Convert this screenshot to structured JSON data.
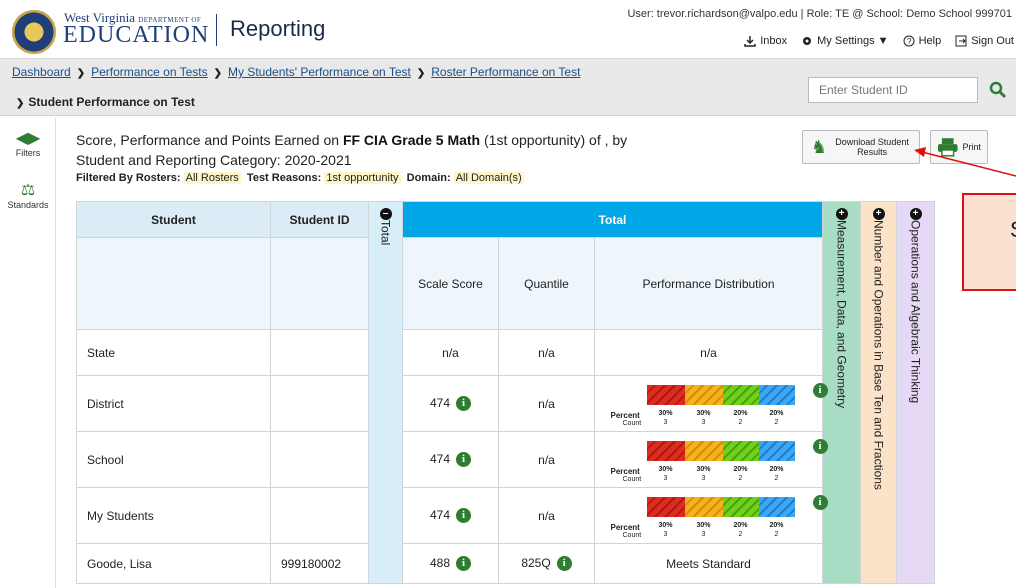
{
  "header": {
    "org_line": "West Virginia",
    "org_dept": "DEPARTMENT OF",
    "org_name": "EDUCATION",
    "app_title": "Reporting",
    "user_line": "User: trevor.richardson@valpo.edu  |  Role: TE @ School: Demo School 999701",
    "inbox": "Inbox",
    "settings": "My Settings ▼",
    "help": "Help",
    "signout": "Sign Out"
  },
  "breadcrumb": {
    "items": [
      "Dashboard",
      "Performance on Tests",
      "My Students' Performance on Test",
      "Roster Performance on Test"
    ],
    "current": "Student Performance on Test"
  },
  "search": {
    "placeholder": "Enter Student ID"
  },
  "rail": {
    "filters": "Filters",
    "standards": "Standards"
  },
  "report": {
    "title_prefix": "Score, Performance and Points Earned on ",
    "test_name": "FF CIA Grade 5 Math",
    "title_suffix": " (1st opportunity) of , by",
    "subtitle": "Student and Reporting Category: 2020-2021",
    "filtered_by": "Filtered By",
    "rosters_label": "Rosters:",
    "rosters_value": "All Rosters",
    "reasons_label": "Test Reasons:",
    "reasons_value": "1st opportunity",
    "domain_label": "Domain:",
    "domain_value": "All Domain(s)",
    "download_label": "Download Student Results",
    "print_label": "Print"
  },
  "callout": {
    "text": "S"
  },
  "table": {
    "headers": {
      "student": "Student",
      "student_id": "Student ID",
      "total_collapsed": "Total",
      "total": "Total",
      "scale_score": "Scale Score",
      "quantile": "Quantile",
      "perf_dist": "Performance Distribution",
      "cat1": "Measurement, Data, and Geometry",
      "cat2": "Number and Operations in Base Ten and Fractions",
      "cat3": "Operations and Algebraic Thinking"
    },
    "dist_labels": {
      "percent": "Percent",
      "count": "Count"
    },
    "rows": [
      {
        "name": "State",
        "id": "",
        "scale": "n/a",
        "quantile": "n/a",
        "perf": "n/a"
      },
      {
        "name": "District",
        "id": "",
        "scale": "474",
        "quantile": "n/a",
        "percents": [
          "30%",
          "30%",
          "20%",
          "20%"
        ],
        "counts": [
          "3",
          "3",
          "2",
          "2"
        ]
      },
      {
        "name": "School",
        "id": "",
        "scale": "474",
        "quantile": "n/a",
        "percents": [
          "30%",
          "30%",
          "20%",
          "20%"
        ],
        "counts": [
          "3",
          "3",
          "2",
          "2"
        ]
      },
      {
        "name": "My Students",
        "id": "",
        "scale": "474",
        "quantile": "n/a",
        "percents": [
          "30%",
          "30%",
          "20%",
          "20%"
        ],
        "counts": [
          "3",
          "3",
          "2",
          "2"
        ]
      },
      {
        "name": "Goode, Lisa",
        "id": "999180002",
        "scale": "488",
        "quantile": "825Q",
        "perf": "Meets Standard"
      }
    ]
  },
  "colors": {
    "total_header": "#00a6e6",
    "cat1": "#a8dcc4",
    "cat2": "#fbe3c8",
    "cat3": "#e5d9f5",
    "callout_border": "#d11111"
  }
}
